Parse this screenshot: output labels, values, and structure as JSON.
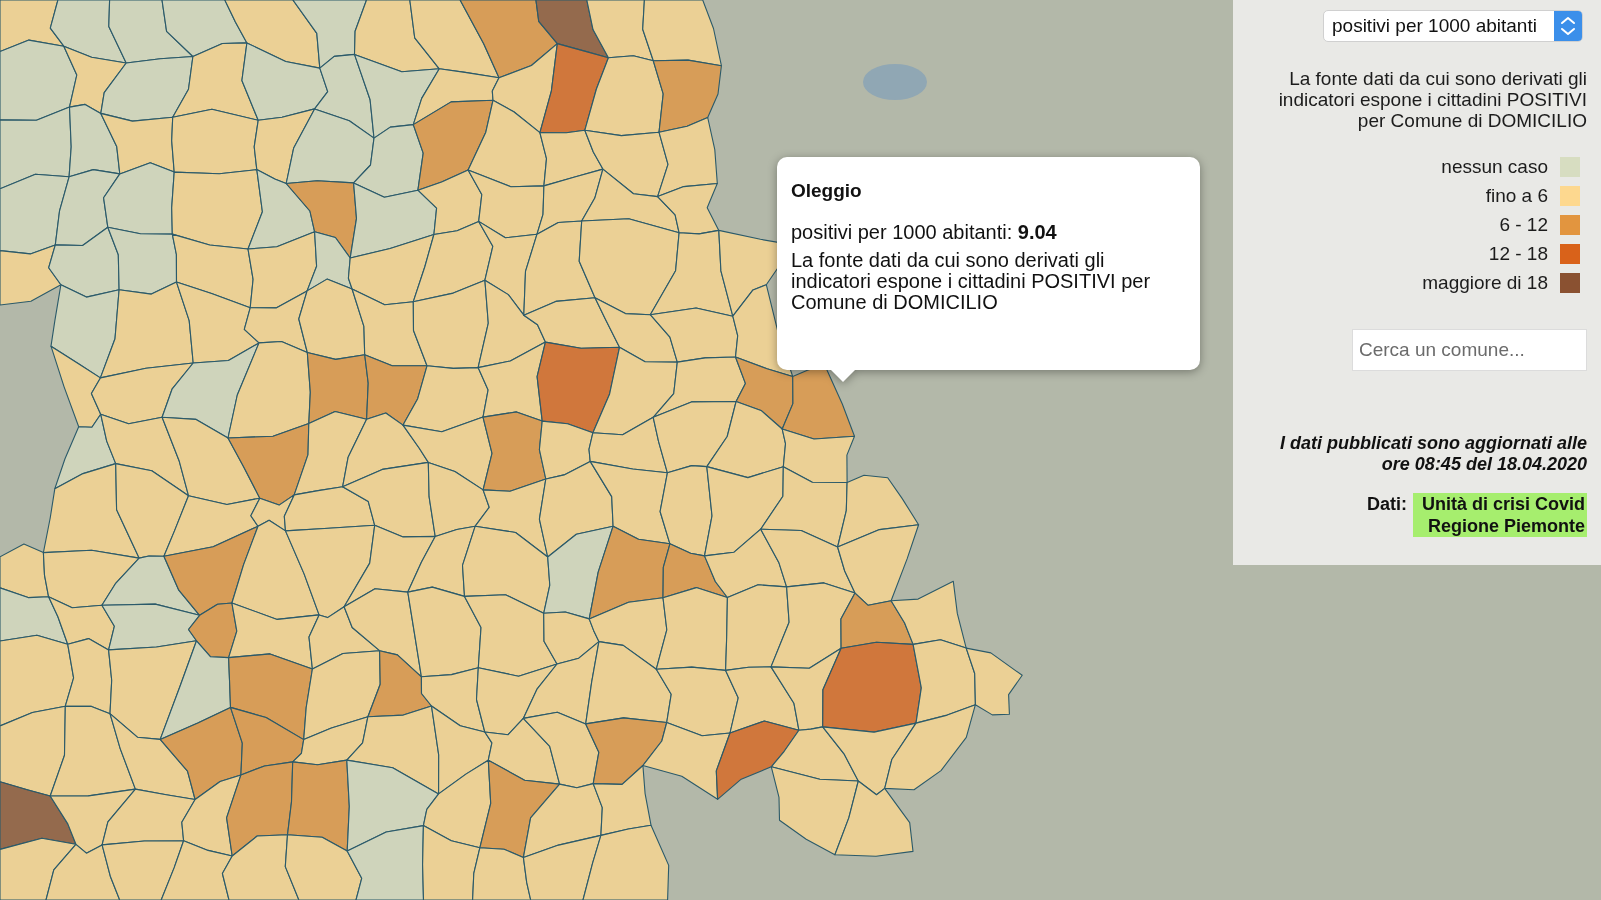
{
  "indicator_select": {
    "value": "positivi per 1000 abitanti"
  },
  "source_note": "La fonte dati da cui sono derivati gli indicatori espone i cittadini POSITIVI per Comune di DOMICILIO",
  "legend": [
    {
      "label": "nessun caso",
      "color": "#d7ddc1"
    },
    {
      "label": "fino a 6",
      "color": "#fdd88f"
    },
    {
      "label": "6 - 12",
      "color": "#e2953f"
    },
    {
      "label": "12 - 18",
      "color": "#d9621a"
    },
    {
      "label": "maggiore di 18",
      "color": "#8a5131"
    }
  ],
  "search": {
    "placeholder": "Cerca un comune..."
  },
  "update_note": "I dati pubblicati sono aggiornati alle ore 08:45 del 18.04.2020",
  "credits": {
    "label": "Dati:",
    "link": "Unità di crisi Covid Regione Piemonte"
  },
  "tooltip": {
    "title": "Oleggio",
    "value": "positivi per 1000 abitanti: **9.04**",
    "note": "La fonte dati da cui sono derivati gli indicatori espone i cittadini POSITIVI per Comune di DOMICILIO"
  }
}
